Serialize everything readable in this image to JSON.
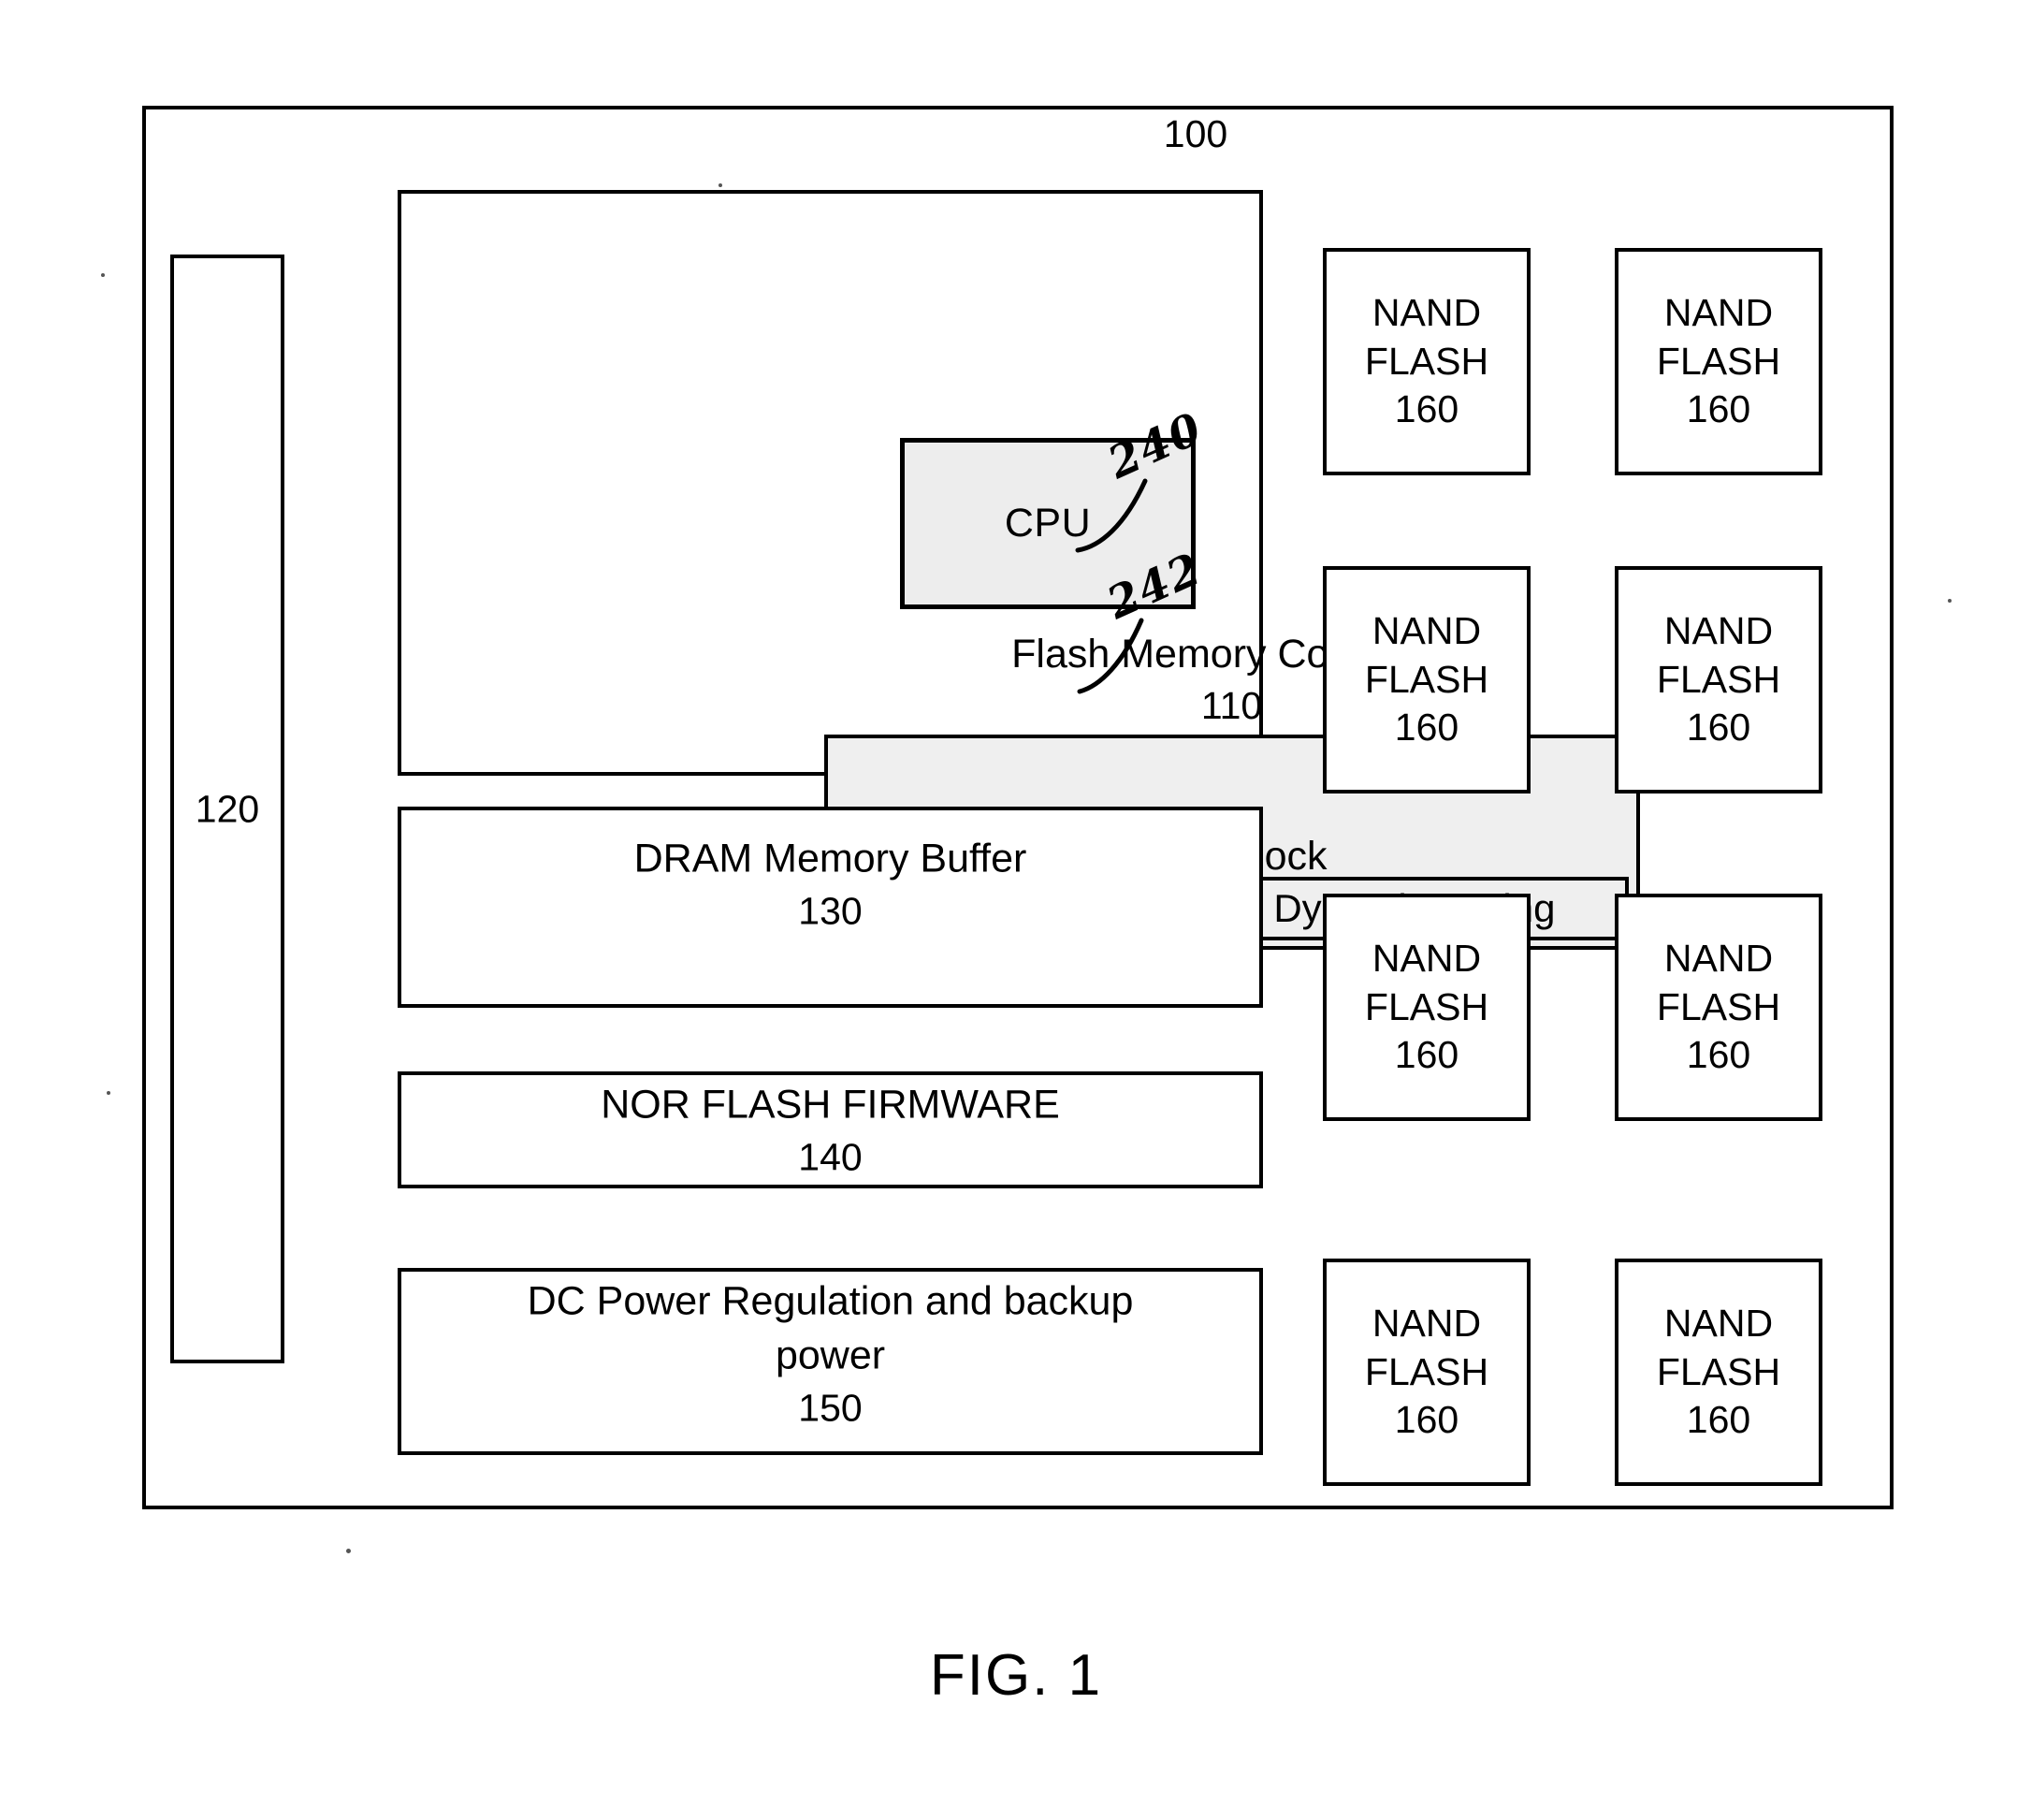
{
  "figure": {
    "caption": "FIG. 1",
    "system_ref": "100"
  },
  "host_connector": {
    "ref": "120"
  },
  "flash_controller": {
    "title": "Flash Memory Controller",
    "ref": "110",
    "cpu": {
      "label": "CPU"
    },
    "ecc": {
      "label": "ECC block",
      "annotation_ref": "240"
    },
    "ldpc": {
      "label": "LDPC Decoder With Dynamic Tuning",
      "annotation_ref": "242"
    }
  },
  "blocks": [
    {
      "title": "DRAM Memory Buffer",
      "ref": "130"
    },
    {
      "title": "NOR FLASH FIRMWARE",
      "ref": "140"
    }
  ],
  "power_block": {
    "title_line1": "DC Power Regulation and backup",
    "title_line2": "power",
    "ref": "150"
  },
  "nand_flash": {
    "line1": "NAND",
    "line2": "FLASH",
    "ref": "160",
    "count": 8,
    "items": [
      {
        "line1": "NAND",
        "line2": "FLASH",
        "ref": "160"
      },
      {
        "line1": "NAND",
        "line2": "FLASH",
        "ref": "160"
      },
      {
        "line1": "NAND",
        "line2": "FLASH",
        "ref": "160"
      },
      {
        "line1": "NAND",
        "line2": "FLASH",
        "ref": "160"
      },
      {
        "line1": "NAND",
        "line2": "FLASH",
        "ref": "160"
      },
      {
        "line1": "NAND",
        "line2": "FLASH",
        "ref": "160"
      },
      {
        "line1": "NAND",
        "line2": "FLASH",
        "ref": "160"
      },
      {
        "line1": "NAND",
        "line2": "FLASH",
        "ref": "160"
      }
    ]
  },
  "colors": {
    "ink": "#000000",
    "paper": "#ffffff",
    "cpu_fill": "#ededed",
    "ecc_fill": "#efefef"
  }
}
